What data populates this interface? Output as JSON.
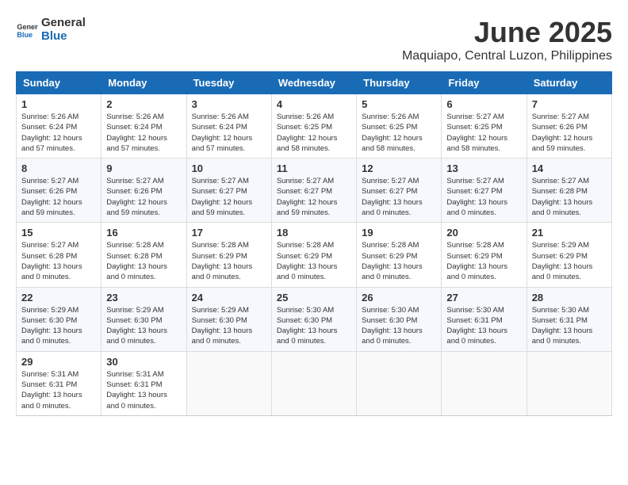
{
  "logo": {
    "line1": "General",
    "line2": "Blue"
  },
  "title": "June 2025",
  "location": "Maquiapo, Central Luzon, Philippines",
  "days_of_week": [
    "Sunday",
    "Monday",
    "Tuesday",
    "Wednesday",
    "Thursday",
    "Friday",
    "Saturday"
  ],
  "weeks": [
    [
      {
        "day": "1",
        "info": "Sunrise: 5:26 AM\nSunset: 6:24 PM\nDaylight: 12 hours\nand 57 minutes."
      },
      {
        "day": "2",
        "info": "Sunrise: 5:26 AM\nSunset: 6:24 PM\nDaylight: 12 hours\nand 57 minutes."
      },
      {
        "day": "3",
        "info": "Sunrise: 5:26 AM\nSunset: 6:24 PM\nDaylight: 12 hours\nand 57 minutes."
      },
      {
        "day": "4",
        "info": "Sunrise: 5:26 AM\nSunset: 6:25 PM\nDaylight: 12 hours\nand 58 minutes."
      },
      {
        "day": "5",
        "info": "Sunrise: 5:26 AM\nSunset: 6:25 PM\nDaylight: 12 hours\nand 58 minutes."
      },
      {
        "day": "6",
        "info": "Sunrise: 5:27 AM\nSunset: 6:25 PM\nDaylight: 12 hours\nand 58 minutes."
      },
      {
        "day": "7",
        "info": "Sunrise: 5:27 AM\nSunset: 6:26 PM\nDaylight: 12 hours\nand 59 minutes."
      }
    ],
    [
      {
        "day": "8",
        "info": "Sunrise: 5:27 AM\nSunset: 6:26 PM\nDaylight: 12 hours\nand 59 minutes."
      },
      {
        "day": "9",
        "info": "Sunrise: 5:27 AM\nSunset: 6:26 PM\nDaylight: 12 hours\nand 59 minutes."
      },
      {
        "day": "10",
        "info": "Sunrise: 5:27 AM\nSunset: 6:27 PM\nDaylight: 12 hours\nand 59 minutes."
      },
      {
        "day": "11",
        "info": "Sunrise: 5:27 AM\nSunset: 6:27 PM\nDaylight: 12 hours\nand 59 minutes."
      },
      {
        "day": "12",
        "info": "Sunrise: 5:27 AM\nSunset: 6:27 PM\nDaylight: 13 hours\nand 0 minutes."
      },
      {
        "day": "13",
        "info": "Sunrise: 5:27 AM\nSunset: 6:27 PM\nDaylight: 13 hours\nand 0 minutes."
      },
      {
        "day": "14",
        "info": "Sunrise: 5:27 AM\nSunset: 6:28 PM\nDaylight: 13 hours\nand 0 minutes."
      }
    ],
    [
      {
        "day": "15",
        "info": "Sunrise: 5:27 AM\nSunset: 6:28 PM\nDaylight: 13 hours\nand 0 minutes."
      },
      {
        "day": "16",
        "info": "Sunrise: 5:28 AM\nSunset: 6:28 PM\nDaylight: 13 hours\nand 0 minutes."
      },
      {
        "day": "17",
        "info": "Sunrise: 5:28 AM\nSunset: 6:29 PM\nDaylight: 13 hours\nand 0 minutes."
      },
      {
        "day": "18",
        "info": "Sunrise: 5:28 AM\nSunset: 6:29 PM\nDaylight: 13 hours\nand 0 minutes."
      },
      {
        "day": "19",
        "info": "Sunrise: 5:28 AM\nSunset: 6:29 PM\nDaylight: 13 hours\nand 0 minutes."
      },
      {
        "day": "20",
        "info": "Sunrise: 5:28 AM\nSunset: 6:29 PM\nDaylight: 13 hours\nand 0 minutes."
      },
      {
        "day": "21",
        "info": "Sunrise: 5:29 AM\nSunset: 6:29 PM\nDaylight: 13 hours\nand 0 minutes."
      }
    ],
    [
      {
        "day": "22",
        "info": "Sunrise: 5:29 AM\nSunset: 6:30 PM\nDaylight: 13 hours\nand 0 minutes."
      },
      {
        "day": "23",
        "info": "Sunrise: 5:29 AM\nSunset: 6:30 PM\nDaylight: 13 hours\nand 0 minutes."
      },
      {
        "day": "24",
        "info": "Sunrise: 5:29 AM\nSunset: 6:30 PM\nDaylight: 13 hours\nand 0 minutes."
      },
      {
        "day": "25",
        "info": "Sunrise: 5:30 AM\nSunset: 6:30 PM\nDaylight: 13 hours\nand 0 minutes."
      },
      {
        "day": "26",
        "info": "Sunrise: 5:30 AM\nSunset: 6:30 PM\nDaylight: 13 hours\nand 0 minutes."
      },
      {
        "day": "27",
        "info": "Sunrise: 5:30 AM\nSunset: 6:31 PM\nDaylight: 13 hours\nand 0 minutes."
      },
      {
        "day": "28",
        "info": "Sunrise: 5:30 AM\nSunset: 6:31 PM\nDaylight: 13 hours\nand 0 minutes."
      }
    ],
    [
      {
        "day": "29",
        "info": "Sunrise: 5:31 AM\nSunset: 6:31 PM\nDaylight: 13 hours\nand 0 minutes."
      },
      {
        "day": "30",
        "info": "Sunrise: 5:31 AM\nSunset: 6:31 PM\nDaylight: 13 hours\nand 0 minutes."
      },
      {
        "day": "",
        "info": ""
      },
      {
        "day": "",
        "info": ""
      },
      {
        "day": "",
        "info": ""
      },
      {
        "day": "",
        "info": ""
      },
      {
        "day": "",
        "info": ""
      }
    ]
  ]
}
